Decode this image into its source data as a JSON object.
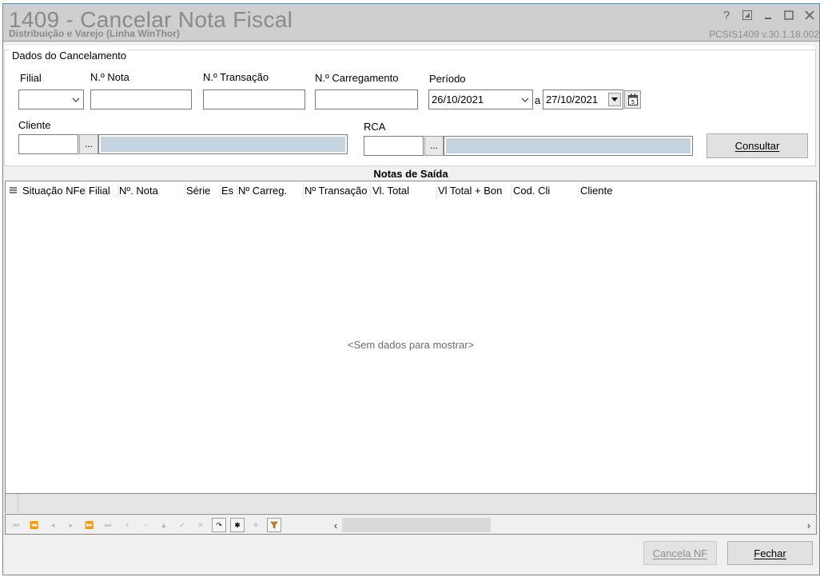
{
  "window": {
    "title": "1409 - Cancelar Nota Fiscal",
    "subtitle": "Distribuição e Varejo (Linha WinThor)",
    "version": "PCSIS1409  v.30.1.18.002",
    "controls": {
      "help": "?",
      "minimize_icon": "minimize-icon",
      "maximize_icon": "maximize-icon",
      "close_icon": "close-icon"
    }
  },
  "filters": {
    "group_title": "Dados do Cancelamento",
    "filial_label": "Filial",
    "nota_label": "N.º Nota",
    "transacao_label": "N.º Transação",
    "carregamento_label": "N.º Carregamento",
    "periodo_label": "Período",
    "date_from": "26/10/2021",
    "date_sep": "a",
    "date_to": "27/10/2021",
    "cliente_label": "Cliente",
    "rca_label": "RCA",
    "ellipsis": "...",
    "consultar_label": "Consultar"
  },
  "grid": {
    "title": "Notas de Saída",
    "columns": [
      "Situação NFe",
      "Filial",
      "Nº. Nota",
      "Série",
      "Es",
      "Nº Carreg.",
      "Nº Transação",
      "Vl. Total",
      "Vl Total + Bon",
      "Cod. Cli",
      "Cliente"
    ],
    "empty_text": "<Sem dados para mostrar>"
  },
  "actions": {
    "cancela_label": "Cancela NF",
    "fechar_label": "Fechar"
  },
  "colors": {
    "titlebar": "#cfcfcf",
    "readonly_field": "#c5d3df",
    "filter_icon": "#d4820f"
  }
}
